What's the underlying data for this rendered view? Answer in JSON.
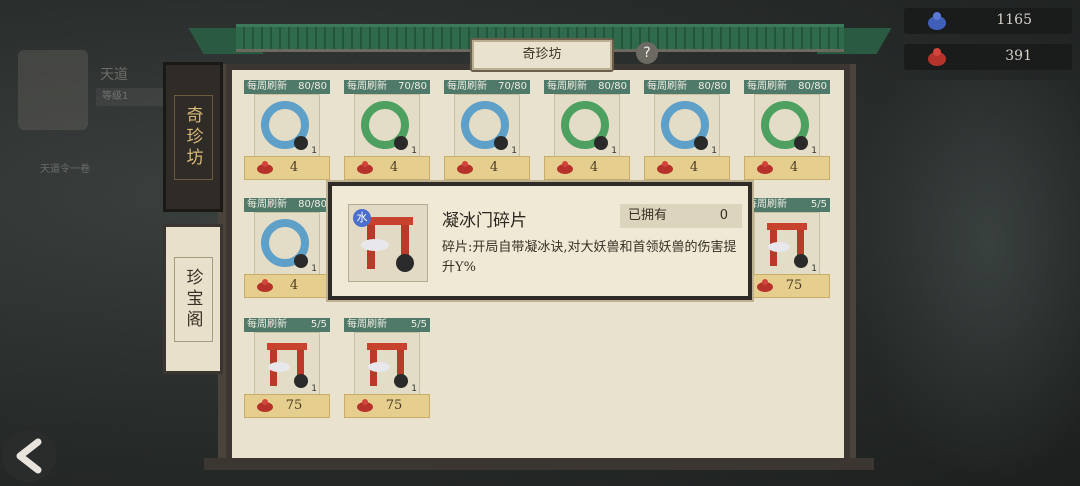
{
  "profile": {
    "name": "天道",
    "rank": "等级1",
    "note": "天道令一卷"
  },
  "currencies": [
    {
      "icon": "blue-gourd-icon",
      "value": "1165"
    },
    {
      "icon": "red-gourd-icon",
      "value": "391"
    }
  ],
  "header": {
    "title": "奇珍坊",
    "help": "?"
  },
  "tabs": [
    {
      "label": "奇珍坊",
      "active": true
    },
    {
      "label": "珍宝阁",
      "active": false
    }
  ],
  "items": [
    {
      "refresh": "每周刷新",
      "stock": "80/80",
      "price": "4",
      "qty": "1",
      "kind": "ring-blue"
    },
    {
      "refresh": "每周刷新",
      "stock": "70/80",
      "price": "4",
      "qty": "1",
      "kind": "ring-green"
    },
    {
      "refresh": "每周刷新",
      "stock": "70/80",
      "price": "4",
      "qty": "1",
      "kind": "ring-blue"
    },
    {
      "refresh": "每周刷新",
      "stock": "80/80",
      "price": "4",
      "qty": "1",
      "kind": "ring-green"
    },
    {
      "refresh": "每周刷新",
      "stock": "80/80",
      "price": "4",
      "qty": "1",
      "kind": "ring-blue"
    },
    {
      "refresh": "每周刷新",
      "stock": "80/80",
      "price": "4",
      "qty": "1",
      "kind": "ring-green"
    },
    {
      "refresh": "每周刷新",
      "stock": "80/80",
      "price": "4",
      "qty": "1",
      "kind": "ring-blue"
    },
    {
      "refresh": "每周刷新",
      "stock": "5/5",
      "price": "75",
      "qty": "1",
      "kind": "gate"
    },
    {
      "refresh": "每周刷新",
      "stock": "5/5",
      "price": "75",
      "qty": "1",
      "kind": "gate"
    },
    {
      "refresh": "每周刷新",
      "stock": "5/5",
      "price": "75",
      "qty": "1",
      "kind": "gate"
    }
  ],
  "tooltip": {
    "element": "水",
    "name": "凝冰门碎片",
    "owned_label": "已拥有",
    "owned_value": "0",
    "desc": "碎片:开局自带凝冰诀,对大妖兽和首领妖兽的伤害提升Y%"
  },
  "colors": {
    "header_green": "#4f7a6a",
    "price_gold": "#e6cf8e",
    "roof_green": "#2f6a4c"
  }
}
